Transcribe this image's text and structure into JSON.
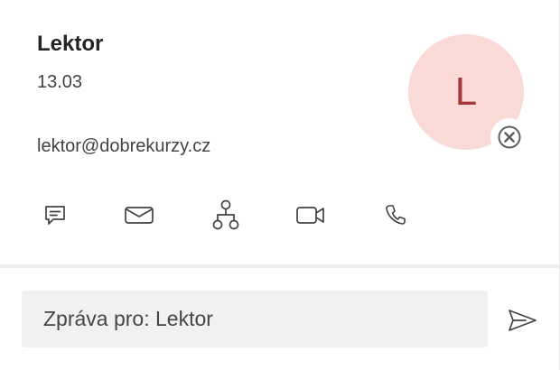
{
  "contact": {
    "name": "Lektor",
    "subtitle": "13.03",
    "email": "lektor@dobrekurzy.cz",
    "avatar_initial": "L",
    "avatar_bg": "#fadad6",
    "avatar_fg": "#a4373a"
  },
  "actions": [
    {
      "icon": "chat-icon"
    },
    {
      "icon": "mail-icon"
    },
    {
      "icon": "org-chart-icon"
    },
    {
      "icon": "video-call-icon"
    },
    {
      "icon": "phone-icon"
    }
  ],
  "composer": {
    "placeholder": "Zpráva pro: Lektor"
  },
  "icons": {
    "remove": "close-circle-icon",
    "send": "send-icon"
  }
}
